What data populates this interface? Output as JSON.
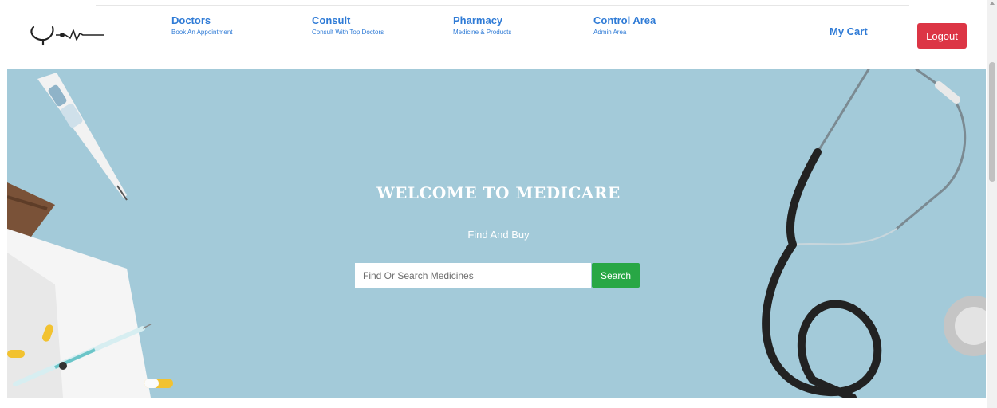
{
  "nav": {
    "items": [
      {
        "title": "Doctors",
        "subtitle": "Book An Appointment"
      },
      {
        "title": "Consult",
        "subtitle": "Consult With Top Doctors"
      },
      {
        "title": "Pharmacy",
        "subtitle": "Medicine & Products"
      },
      {
        "title": "Control Area",
        "subtitle": "Admin Area"
      }
    ],
    "cart_label": "My Cart",
    "logout_label": "Logout"
  },
  "hero": {
    "title": "WELCOME TO MEDICARE",
    "subtitle": "Find And Buy",
    "search_placeholder": "Find Or Search Medicines",
    "search_value": "",
    "search_button_label": "Search"
  },
  "colors": {
    "link": "#2f7bd6",
    "logout": "#dc3545",
    "search_button": "#28a745",
    "hero_background": "#a3cad9"
  },
  "icons": {
    "logo": "stethoscope-heartbeat-logo"
  }
}
